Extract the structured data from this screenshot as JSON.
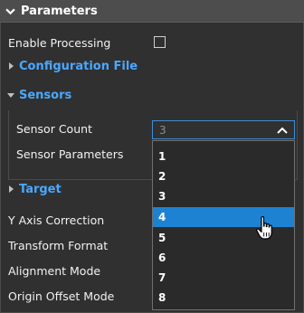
{
  "header": {
    "title": "Parameters"
  },
  "fields": {
    "enable_processing": "Enable Processing",
    "configuration_file": "Configuration File",
    "sensors": "Sensors",
    "sensor_count": "Sensor Count",
    "sensor_count_value": "3",
    "sensor_parameters": "Sensor Parameters",
    "target": "Target",
    "y_axis_correction": "Y Axis Correction",
    "transform_format": "Transform Format",
    "alignment_mode": "Alignment Mode",
    "origin_offset_mode": "Origin Offset Mode"
  },
  "dropdown": {
    "options": [
      "1",
      "2",
      "3",
      "4",
      "5",
      "6",
      "7",
      "8"
    ],
    "highlighted_index": 3
  },
  "colors": {
    "accent": "#4aa8ff",
    "highlight": "#1e82d3",
    "background": "#303030"
  }
}
